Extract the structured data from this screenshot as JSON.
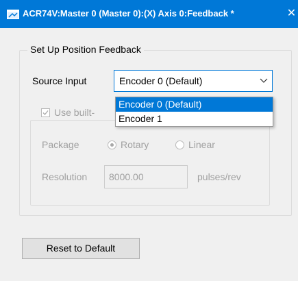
{
  "window": {
    "title": "ACR74V:Master 0 (Master 0):(X) Axis 0:Feedback *",
    "close_glyph": "✕",
    "accent_color": "#0078d7"
  },
  "group": {
    "title": "Set Up Position Feedback",
    "source_input": {
      "label": "Source Input",
      "selected": "Encoder 0 (Default)",
      "open": true,
      "options": [
        "Encoder 0 (Default)",
        "Encoder 1"
      ]
    },
    "builtin_checkbox": {
      "label": "Use built-",
      "checked": true,
      "enabled": false
    },
    "package": {
      "label": "Package",
      "options": [
        {
          "label": "Rotary",
          "selected": true
        },
        {
          "label": "Linear",
          "selected": false
        }
      ]
    },
    "resolution": {
      "label": "Resolution",
      "value": "8000.00",
      "units": "pulses/rev"
    }
  },
  "footer": {
    "reset_label": "Reset to Default"
  },
  "icons": {
    "app": "app-window-icon",
    "close": "close-icon",
    "chevron": "chevron-down-icon",
    "check": "checkmark-icon"
  }
}
